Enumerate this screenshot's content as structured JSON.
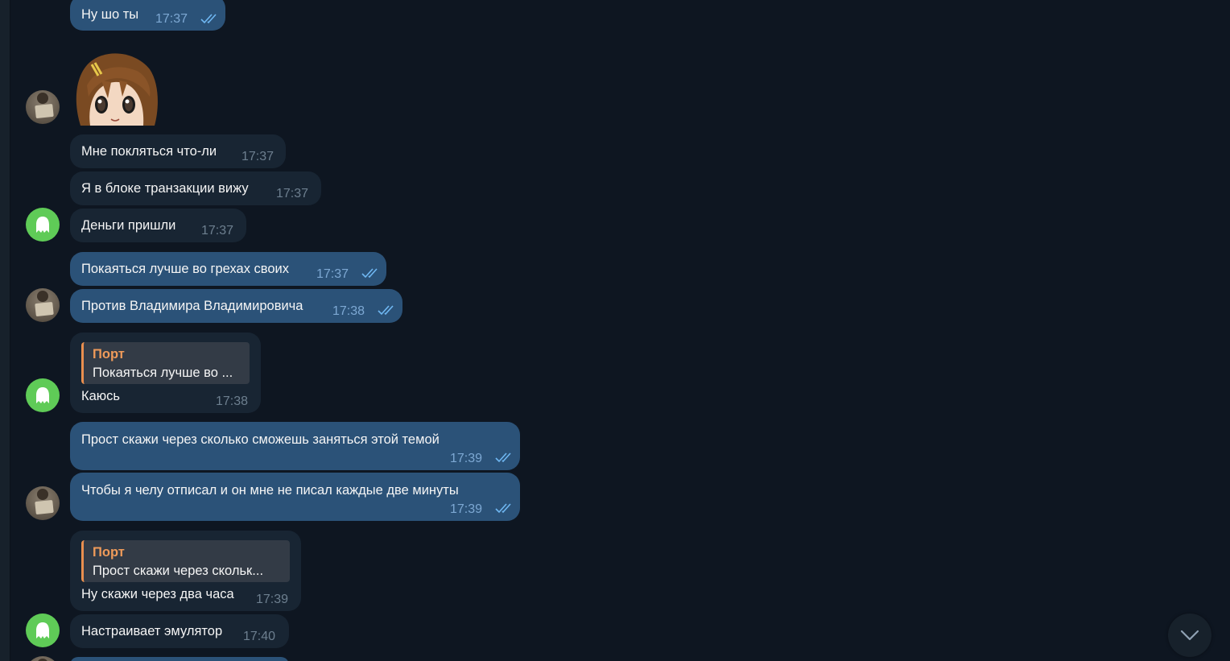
{
  "chat": {
    "messages": [
      {
        "text": "Ну шо ты",
        "time": "17:37",
        "direction": "out",
        "read": true
      },
      {
        "sticker": "anime-girl-sticker",
        "direction": "out"
      },
      {
        "text": "Мне покляться что-ли",
        "time": "17:37",
        "direction": "in"
      },
      {
        "text": "Я в блоке транзакции вижу",
        "time": "17:37",
        "direction": "in"
      },
      {
        "text": "Деньги пришли",
        "time": "17:37",
        "direction": "in"
      },
      {
        "text": "Покаяться лучше во грехах своих",
        "time": "17:37",
        "direction": "out",
        "read": true
      },
      {
        "text": "Против Владимира Владимировича",
        "time": "17:38",
        "direction": "out",
        "read": true
      },
      {
        "reply_name": "Порт",
        "reply_text": "Покаяться лучше во ...",
        "text": "Каюсь",
        "time": "17:38",
        "direction": "in"
      },
      {
        "text": "Прост скажи через сколько сможешь заняться этой темой",
        "time": "17:39",
        "direction": "out",
        "read": true
      },
      {
        "text": "Чтобы я челу отписал и он мне не писал каждые две минуты",
        "time": "17:39",
        "direction": "out",
        "read": true
      },
      {
        "reply_name": "Порт",
        "reply_text": "Прост скажи через скольк...",
        "text": "Ну скажи через два часа",
        "time": "17:39",
        "direction": "in"
      },
      {
        "text": "Настраивает эмулятор",
        "time": "17:40",
        "direction": "in"
      }
    ]
  },
  "icons": {
    "read_checks": "double-check-icon",
    "scroll_down": "chevron-down-icon",
    "ghost_avatar": "ghost-icon"
  },
  "colors": {
    "background": "#0e1621",
    "outgoing_bubble": "#2b5278",
    "incoming_bubble": "#182533",
    "reply_accent": "#ea8f4f",
    "ghost_avatar": "#5fcb57"
  }
}
